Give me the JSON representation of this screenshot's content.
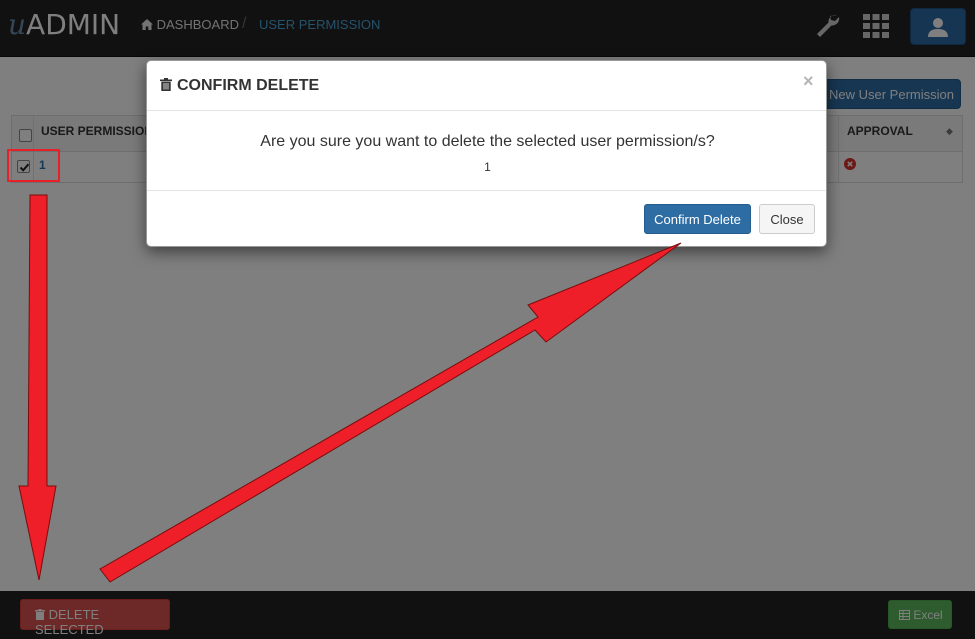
{
  "app": {
    "logo_mark": "u",
    "logo_text": "ADMIN"
  },
  "breadcrumb": {
    "home_label": "DASHBOARD",
    "separator": "/",
    "current_label": "USER PERMISSION"
  },
  "toolbar": {
    "new_button_label": "New User Permission"
  },
  "table": {
    "headers": {
      "permission": "USER PERMISSION",
      "approval": "APPROVAL"
    },
    "rows": [
      {
        "id": "1",
        "checked": true,
        "approval_icon": "x-circle-icon"
      }
    ]
  },
  "footer": {
    "delete_label": "DELETE SELECTED",
    "excel_label": "Excel"
  },
  "modal": {
    "title": "CONFIRM DELETE",
    "close_glyph": "×",
    "message": "Are you sure you want to delete the selected user permission/s?",
    "selected_ids": "1",
    "confirm_label": "Confirm Delete",
    "close_label": "Close"
  },
  "colors": {
    "navbar": "#222222",
    "primary": "#2e6da4",
    "danger": "#d9534f",
    "success": "#5cb85c",
    "annotation": "#e8202a"
  },
  "icons": [
    "home-icon",
    "wrench-icon",
    "apps-grid-icon",
    "user-icon",
    "trash-icon",
    "table-icon",
    "check-icon",
    "x-circle-icon"
  ]
}
